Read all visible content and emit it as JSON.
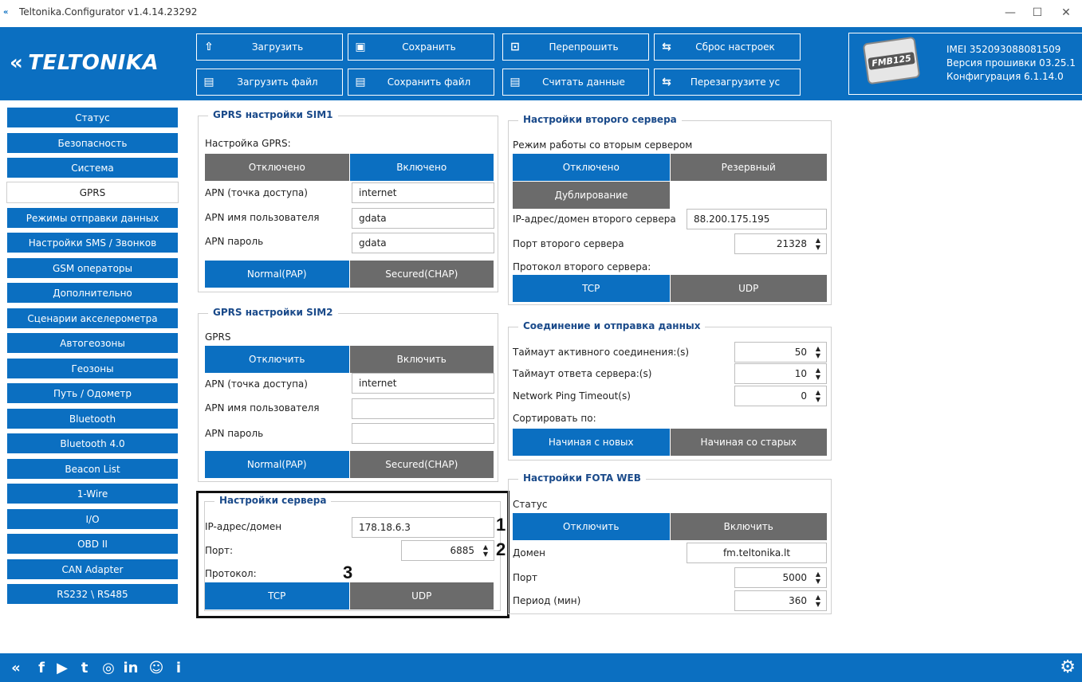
{
  "window": {
    "title": "Teltonika.Configurator v1.4.14.23292",
    "minimize": "—",
    "maximize": "☐",
    "close": "✕"
  },
  "brand": {
    "logo_text": "TELTONIKA",
    "mark": "«"
  },
  "toolbar": {
    "load": "Загрузить",
    "save": "Сохранить",
    "reflash": "Перепрошить",
    "reset": "Сброс настроек",
    "load_file": "Загрузить файл",
    "save_file": "Сохранить файл",
    "read_data": "Считать данные",
    "reboot": "Перезагрузите ус"
  },
  "device": {
    "model": "FMB125",
    "imei": "IMEI 352093088081509",
    "firmware": "Версия прошивки 03.25.1",
    "config": "Конфигурация 6.1.14.0"
  },
  "sidebar": {
    "items": [
      {
        "label": "Статус"
      },
      {
        "label": "Безопасность"
      },
      {
        "label": "Система"
      },
      {
        "label": "GPRS",
        "active": true
      },
      {
        "label": "Режимы отправки данных"
      },
      {
        "label": "Настройки SMS / Звонков"
      },
      {
        "label": "GSM операторы"
      },
      {
        "label": "Дополнительно"
      },
      {
        "label": "Сценарии акселерометра"
      },
      {
        "label": "Автогеозоны"
      },
      {
        "label": "Геозоны"
      },
      {
        "label": "Путь / Одометр"
      },
      {
        "label": "Bluetooth"
      },
      {
        "label": "Bluetooth 4.0"
      },
      {
        "label": "Beacon List"
      },
      {
        "label": "1-Wire"
      },
      {
        "label": "I/O"
      },
      {
        "label": "OBD II"
      },
      {
        "label": "CAN Adapter"
      },
      {
        "label": "RS232 \\ RS485"
      }
    ]
  },
  "sim1": {
    "title": "GPRS настройки SIM1",
    "gprs_label": "Настройка GPRS:",
    "off": "Отключено",
    "on": "Включено",
    "apn_label": "APN (точка доступа)",
    "apn_value": "internet",
    "user_label": "APN имя пользователя",
    "user_value": "gdata",
    "pass_label": "APN пароль",
    "pass_value": "gdata",
    "auth_pap": "Normal(PAP)",
    "auth_chap": "Secured(CHAP)"
  },
  "sim2": {
    "title": "GPRS настройки SIM2",
    "gprs_label": "GPRS",
    "off": "Отключить",
    "on": "Включить",
    "apn_label": "APN (точка доступа)",
    "apn_value": "internet",
    "user_label": "APN имя пользователя",
    "user_value": "",
    "pass_label": "APN пароль",
    "pass_value": "",
    "auth_pap": "Normal(PAP)",
    "auth_chap": "Secured(CHAP)"
  },
  "server": {
    "title": "Настройки сервера",
    "ip_label": "IP-адрес/домен",
    "ip_value": "178.18.6.3",
    "port_label": "Порт:",
    "port_value": "6885",
    "protocol_label": "Протокол:",
    "tcp": "TCP",
    "udp": "UDP",
    "marks": [
      "1",
      "2",
      "3"
    ]
  },
  "second_server": {
    "title": "Настройки второго сервера",
    "mode_label": "Режим работы со вторым сервером",
    "off": "Отключено",
    "backup": "Резервный",
    "duplicate": "Дублирование",
    "ip_label": "IP-адрес/домен второго сервера",
    "ip_value": "88.200.175.195",
    "port_label": "Порт второго сервера",
    "port_value": "21328",
    "protocol_label": "Протокол второго сервера:",
    "tcp": "TCP",
    "udp": "UDP"
  },
  "connection": {
    "title": "Соединение и отправка данных",
    "active_timeout_label": "Таймаут активного соединения:(s)",
    "active_timeout_value": "50",
    "response_timeout_label": "Таймаут ответа сервера:(s)",
    "response_timeout_value": "10",
    "ping_label": "Network Ping Timeout(s)",
    "ping_value": "0",
    "sort_label": "Сортировать по:",
    "newest": "Начиная с новых",
    "oldest": "Начиная со старых"
  },
  "fota": {
    "title": "Настройки FOTA WEB",
    "status_label": "Статус",
    "off": "Отключить",
    "on": "Включить",
    "domain_label": "Домен",
    "domain_value": "fm.teltonika.lt",
    "port_label": "Порт",
    "port_value": "5000",
    "period_label": "Период (мин)",
    "period_value": "360"
  },
  "footer": {
    "icons": [
      "teltonika-icon",
      "facebook-icon",
      "youtube-icon",
      "twitter-icon",
      "instagram-icon",
      "linkedin-icon",
      "chat-icon",
      "info-icon"
    ],
    "glyphs": [
      "«",
      "f",
      "▶",
      "t",
      "◎",
      "in",
      "☺",
      "i"
    ],
    "gear": "⚙"
  },
  "colors": {
    "accent": "#0b6fc1",
    "inactive": "#6b6b6b"
  }
}
